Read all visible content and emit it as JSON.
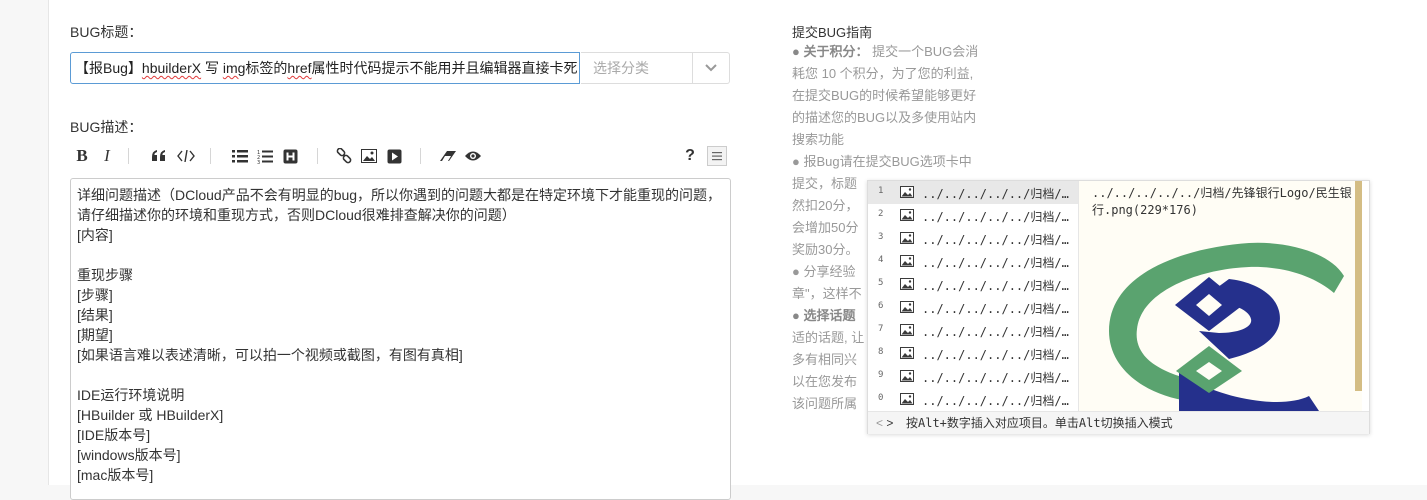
{
  "form": {
    "title_label": "BUG标题：",
    "title_parts": [
      "【报Bug】",
      "hbuilderX",
      " 写 ",
      "img",
      "标签的",
      "href",
      "属性时代码提示不能用并且编辑器直接卡死"
    ],
    "category_placeholder": "选择分类",
    "desc_label": "BUG描述："
  },
  "toolbar": {
    "bold": "B",
    "italic": "I",
    "help": "?"
  },
  "editor": {
    "lines": [
      "详细问题描述（DCloud产品不会有明显的bug，所以你遇到的问题大都是在特定环境下才能重现的问题，",
      "请仔细描述你的环境和重现方式，否则DCloud很难排查解决你的问题）",
      "[内容]",
      "",
      "重现步骤",
      "[步骤]",
      "[结果]",
      "[期望]",
      "[如果语言难以表述清晰，可以拍一个视频或截图，有图有真相]",
      "",
      "IDE运行环境说明",
      "[HBuilder 或 HBuilderX]",
      "[IDE版本号]",
      "[windows版本号]",
      "[mac版本号]"
    ]
  },
  "guide": {
    "heading": "提交BUG指南",
    "lines": [
      {
        "b": "● 关于积分：",
        "t": " 提交一个BUG会消"
      },
      {
        "b": "",
        "t": "耗您 10 个积分，为了您的利益,"
      },
      {
        "b": "",
        "t": "在提交BUG的时候希望能够更好"
      },
      {
        "b": "",
        "t": "的描述您的BUG以及多使用站内"
      },
      {
        "b": "",
        "t": "搜索功能"
      },
      {
        "b": "",
        "t": "● 报Bug请在提交BUG选项卡中"
      },
      {
        "b": "",
        "t": "提交，标题"
      },
      {
        "b": "",
        "t": "然扣20分，"
      },
      {
        "b": "",
        "t": "会增加50分"
      },
      {
        "b": "",
        "t": "奖励30分。"
      },
      {
        "b": "",
        "t": "● 分享经验"
      },
      {
        "b": "",
        "t": "章\"，这样不"
      },
      {
        "b": "● 选择话题",
        "t": ""
      },
      {
        "b": "",
        "t": "适的话题, 让"
      },
      {
        "b": "",
        "t": "多有相同兴"
      },
      {
        "b": "",
        "t": "以在您发布"
      },
      {
        "b": "",
        "t": "该问题所属"
      }
    ]
  },
  "hint": {
    "items": [
      {
        "num": "1",
        "text": "../../../../../归档/…"
      },
      {
        "num": "2",
        "text": "../../../../../归档/…"
      },
      {
        "num": "3",
        "text": "../../../../../归档/…"
      },
      {
        "num": "4",
        "text": "../../../../../归档/…"
      },
      {
        "num": "5",
        "text": "../../../../../归档/…"
      },
      {
        "num": "6",
        "text": "../../../../../归档/…"
      },
      {
        "num": "7",
        "text": "../../../../../归档/…"
      },
      {
        "num": "8",
        "text": "../../../../../归档/…"
      },
      {
        "num": "9",
        "text": "../../../../../归档/…"
      },
      {
        "num": "0",
        "text": "../../../../../归档/…"
      }
    ],
    "preview_caption": "../../../../../归档/先锋银行Logo/民生银行.png(229*176)",
    "footer": "按Alt+数字插入对应项目。单击Alt切换插入模式",
    "logo_colors": {
      "green": "#5aa36f",
      "blue": "#25308c"
    }
  }
}
